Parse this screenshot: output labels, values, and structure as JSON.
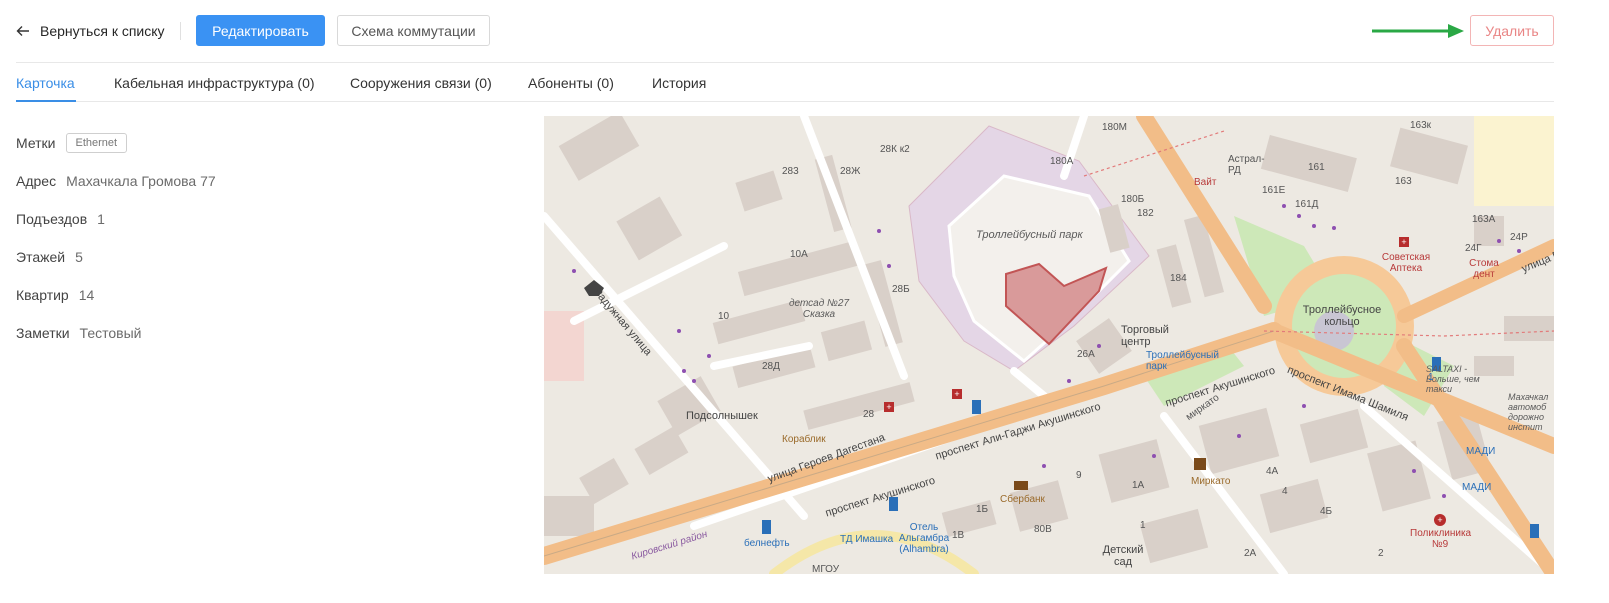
{
  "toolbar": {
    "back_label": "Вернуться к списку",
    "edit_label": "Редактировать",
    "scheme_label": "Схема коммутации",
    "delete_label": "Удалить",
    "accent_color": "#3a92f3",
    "danger_color": "#e98585",
    "arrow_color": "#2aa845"
  },
  "tabs": [
    {
      "label": "Карточка",
      "active": true
    },
    {
      "label": "Кабельная инфраструктура (0)",
      "active": false
    },
    {
      "label": "Сооружения связи (0)",
      "active": false
    },
    {
      "label": "Абоненты (0)",
      "active": false
    },
    {
      "label": "История",
      "active": false
    }
  ],
  "card": {
    "tags": {
      "label": "Метки",
      "tag": "Ethernet"
    },
    "address": {
      "label": "Адрес",
      "value": "Махачкала Громова 77"
    },
    "entrances": {
      "label": "Подъездов",
      "value": "1"
    },
    "floors": {
      "label": "Этажей",
      "value": "5"
    },
    "apartments": {
      "label": "Квартир",
      "value": "14"
    },
    "notes": {
      "label": "Заметки",
      "value": "Тестовый"
    }
  },
  "map": {
    "labels": {
      "park": "Троллейбусный парк",
      "detsad": "детсад №27 Сказка",
      "torgovy": "Торговый центр",
      "tb_park": "Троллейбусный парк",
      "ring": "Троллейбусное кольцо",
      "sovetskaya": "Советская Аптека",
      "stomadent": "Стома дент",
      "astral": "Астрал-РД",
      "vait": "Вайт",
      "podsolnyshek": "Подсолнышек",
      "korablik": "Кораблик",
      "sberbank": "Сбербанк",
      "mirkato": "Миркато",
      "mirkato2": "миркато",
      "poliklinika": "Поликлиника №9",
      "madi": "МАДИ",
      "madi2": "МАДИ",
      "belneft": "белнефть",
      "td_imashka": "ТД Имашка",
      "hotel": "Отель Альгамбра (Alhambra)",
      "detskiy": "Детский сад",
      "kirovsky": "Кировский район",
      "mgou": "МГОУ",
      "saltaxi": "SALTAXI - Больше, чем такси",
      "makhach": "Махачкал автомоб дорожно инстит",
      "b1": "1",
      "str_raduzh": "Радужная улица",
      "str_geroev": "улица Героев Дагестана",
      "str_aliagadzhi": "проспект Али-Гаджи Акушинского",
      "str_akush1": "проспект Акушинского",
      "str_akush2": "проспект Акушинского",
      "str_imama": "проспект Имама Шамиля",
      "str_top": "улица Ге",
      "b180m": "180М",
      "b180a": "180А",
      "b180b": "180Б",
      "b182": "182",
      "b184": "184",
      "b161": "161",
      "b161e": "161Е",
      "b161d": "161Д",
      "b163k": "163к",
      "b163": "163",
      "b163a": "163А",
      "b24g": "24Г",
      "b24r": "24Р",
      "b283": "283",
      "b28zh": "28Ж",
      "b28k2": "28К к2",
      "b10a": "10А",
      "b28b": "28Б",
      "b10": "10",
      "b28d": "28Д",
      "b28": "28",
      "b26a": "26А",
      "b4a": "4А",
      "b4": "4",
      "b4b": "4Б",
      "b2a": "2А",
      "b2": "2",
      "b1a": "1А",
      "b1b": "1Б",
      "b80v": "80В",
      "b9": "9",
      "b1v": "1В"
    }
  }
}
